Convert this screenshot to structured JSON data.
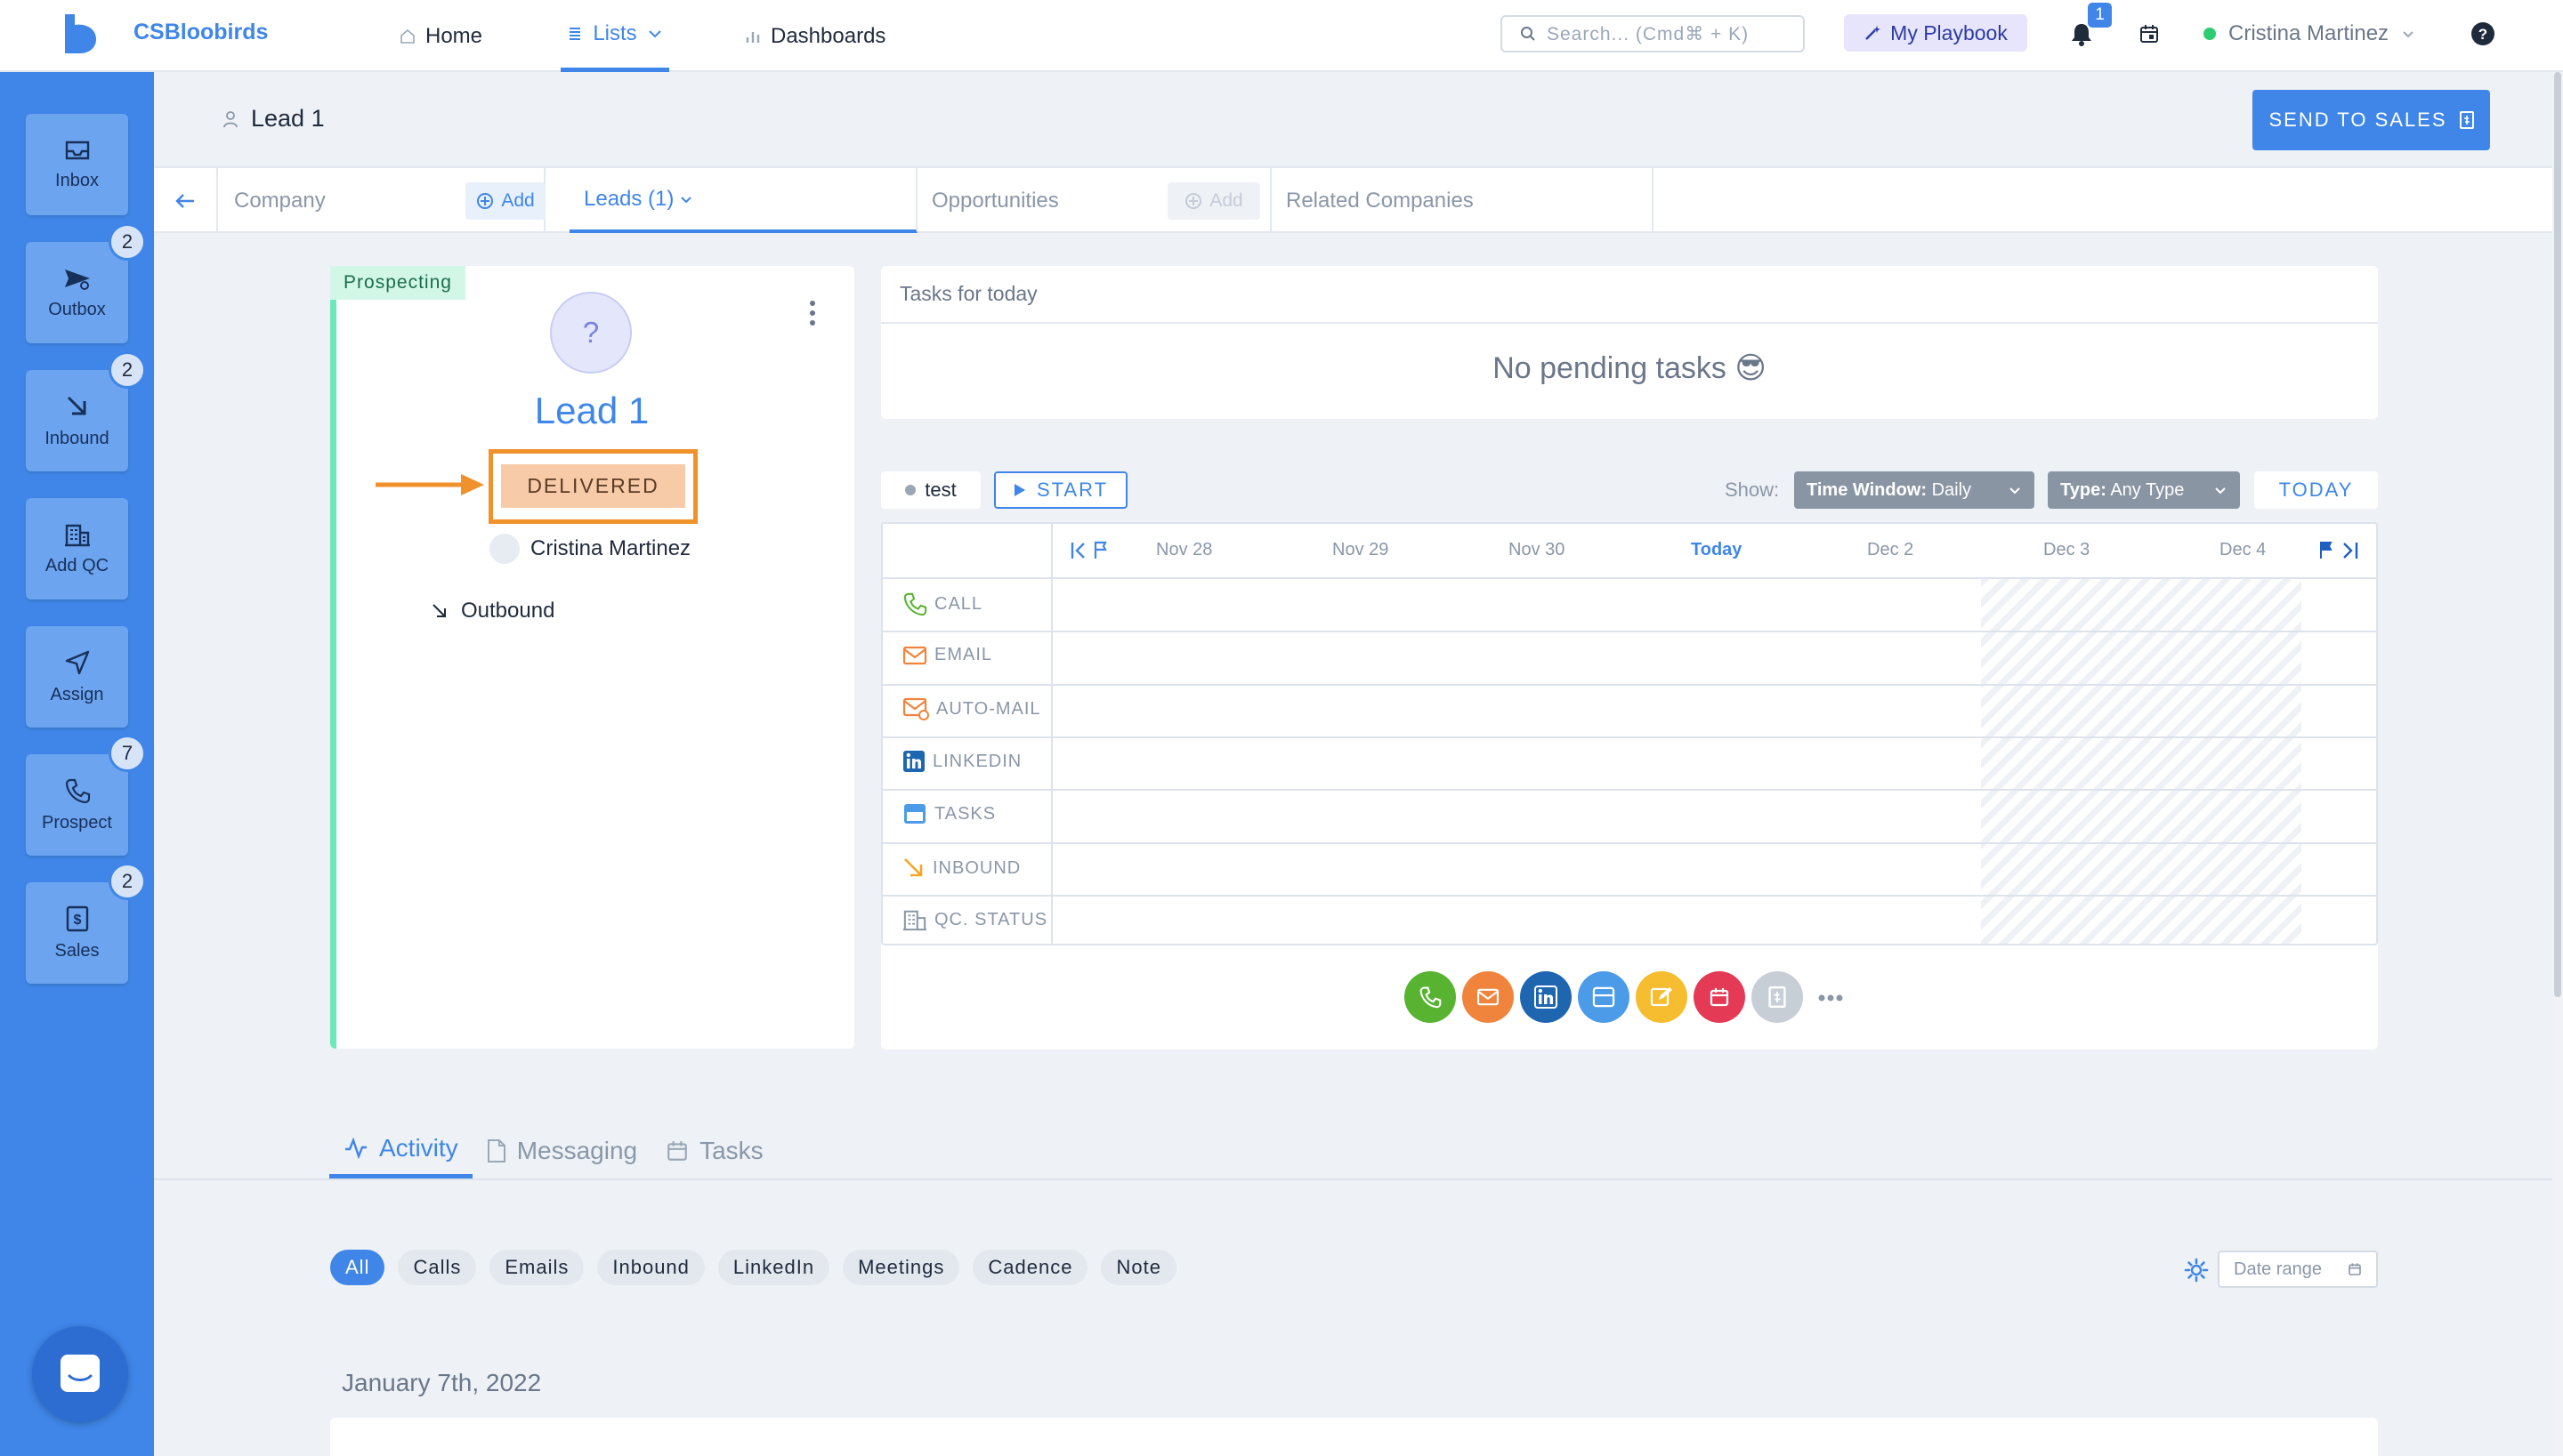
{
  "app": {
    "brand": "CSBloobirds"
  },
  "nav": {
    "home": "Home",
    "lists": "Lists",
    "dashboards": "Dashboards"
  },
  "search": {
    "placeholder": "Search... (Cmd⌘ + K)"
  },
  "playbook": {
    "label": "My Playbook"
  },
  "notifications": {
    "count": "1"
  },
  "user": {
    "name": "Cristina Martinez"
  },
  "sidebar": {
    "items": [
      {
        "label": "Inbox",
        "badge": ""
      },
      {
        "label": "Outbox",
        "badge": "2"
      },
      {
        "label": "Inbound",
        "badge": "2"
      },
      {
        "label": "Add QC",
        "badge": ""
      },
      {
        "label": "Assign",
        "badge": ""
      },
      {
        "label": "Prospect",
        "badge": "7"
      },
      {
        "label": "Sales",
        "badge": "2"
      }
    ]
  },
  "page": {
    "title": "Lead 1",
    "send_button": "SEND TO SALES"
  },
  "tabs": {
    "company": "Company",
    "company_add": "Add",
    "leads": "Leads (1)",
    "opportunities": "Opportunities",
    "opportunities_add": "Add",
    "related": "Related Companies"
  },
  "lead": {
    "stage": "Prospecting",
    "avatar": "?",
    "name": "Lead 1",
    "status": "DELIVERED",
    "owner": "Cristina Martinez",
    "source": "Outbound"
  },
  "tasks_today": {
    "title": "Tasks for for today",
    "empty": "No pending tasks 😎"
  },
  "cadence": {
    "name": "test",
    "start": "START",
    "show_label": "Show:",
    "time_window_label": "Time Window:",
    "time_window_value": "Daily",
    "type_label": "Type:",
    "type_value": "Any Type",
    "today_button": "TODAY",
    "days": [
      "Nov 28",
      "Nov 29",
      "Nov 30",
      "Today",
      "Dec 2",
      "Dec 3",
      "Dec 4"
    ],
    "rows": [
      "CALL",
      "EMAIL",
      "AUTO-MAIL",
      "LINKEDIN",
      "TASKS",
      "INBOUND",
      "QC. STATUS"
    ],
    "colors": {
      "call": "#58b330",
      "email": "#f0843c",
      "linkedin": "#1f66b0",
      "tasks": "#4c9be8",
      "note": "#f5bd2f",
      "meeting": "#e43a56",
      "other": "#c8ced6"
    }
  },
  "bottom_tabs": {
    "activity": "Activity",
    "messaging": "Messaging",
    "tasks": "Tasks"
  },
  "filters": [
    "All",
    "Calls",
    "Emails",
    "Inbound",
    "LinkedIn",
    "Meetings",
    "Cadence",
    "Note"
  ],
  "date_range": {
    "placeholder": "Date range"
  },
  "activity": {
    "date": "January 7th, 2022"
  }
}
